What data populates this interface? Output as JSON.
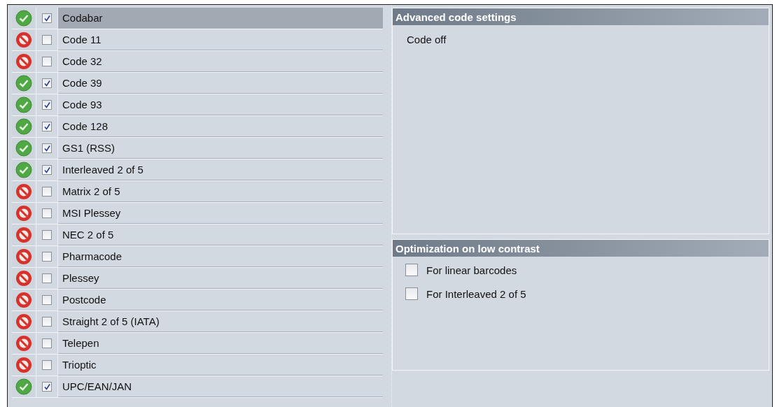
{
  "codes": [
    {
      "label": "Codabar",
      "checked": true,
      "selected": true
    },
    {
      "label": "Code 11",
      "checked": false,
      "selected": false
    },
    {
      "label": "Code 32",
      "checked": false,
      "selected": false
    },
    {
      "label": "Code 39",
      "checked": true,
      "selected": false
    },
    {
      "label": "Code 93",
      "checked": true,
      "selected": false
    },
    {
      "label": "Code 128",
      "checked": true,
      "selected": false
    },
    {
      "label": "GS1 (RSS)",
      "checked": true,
      "selected": false
    },
    {
      "label": "Interleaved 2 of 5",
      "checked": true,
      "selected": false
    },
    {
      "label": "Matrix 2 of 5",
      "checked": false,
      "selected": false
    },
    {
      "label": "MSI Plessey",
      "checked": false,
      "selected": false
    },
    {
      "label": "NEC 2 of 5",
      "checked": false,
      "selected": false
    },
    {
      "label": "Pharmacode",
      "checked": false,
      "selected": false
    },
    {
      "label": "Plessey",
      "checked": false,
      "selected": false
    },
    {
      "label": "Postcode",
      "checked": false,
      "selected": false
    },
    {
      "label": "Straight 2 of 5 (IATA)",
      "checked": false,
      "selected": false
    },
    {
      "label": "Telepen",
      "checked": false,
      "selected": false
    },
    {
      "label": "Trioptic",
      "checked": false,
      "selected": false
    },
    {
      "label": "UPC/EAN/JAN",
      "checked": true,
      "selected": false
    }
  ],
  "advanced": {
    "title": "Advanced code settings",
    "text": "Code off"
  },
  "optimization": {
    "title": "Optimization on low contrast",
    "options": [
      {
        "label": "For linear barcodes",
        "checked": false
      },
      {
        "label": "For Interleaved 2 of 5",
        "checked": false
      }
    ]
  }
}
